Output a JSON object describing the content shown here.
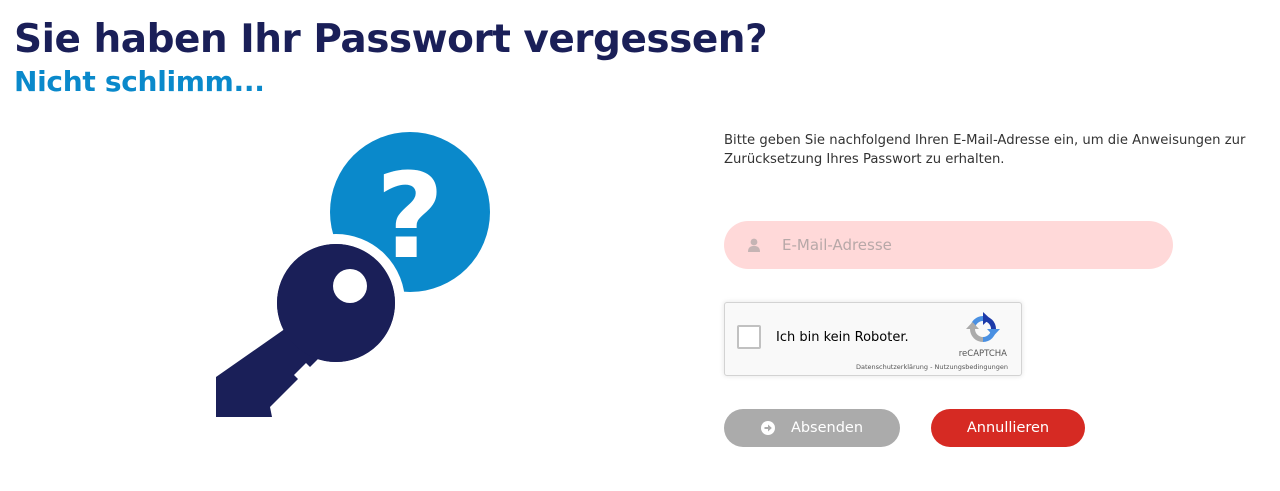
{
  "header": {
    "title": "Sie haben Ihr Passwort vergessen?",
    "subtitle": "Nicht schlimm..."
  },
  "illustration": {
    "icon": "key-with-question-mark",
    "colors": {
      "key": "#1a1f58",
      "bubble": "#0a89cb"
    }
  },
  "form": {
    "intro": "Bitte geben Sie nachfolgend Ihren E-Mail-Adresse ein, um die Anweisungen zur Zurücksetzung Ihres Passwort zu erhalten.",
    "email": {
      "placeholder": "E-Mail-Adresse",
      "value": "",
      "icon": "user-icon"
    },
    "captcha": {
      "label": "Ich bin kein Roboter.",
      "brand": "reCAPTCHA",
      "terms": "Datenschutzerklärung - Nutzungsbedingungen",
      "checked": false
    },
    "submit_label": "Absenden",
    "cancel_label": "Annullieren"
  },
  "colors": {
    "title": "#1a1f58",
    "subtitle": "#0a89cb",
    "email_bg": "#ffd9d9",
    "submit_bg": "#ababab",
    "cancel_bg": "#d62a23"
  }
}
